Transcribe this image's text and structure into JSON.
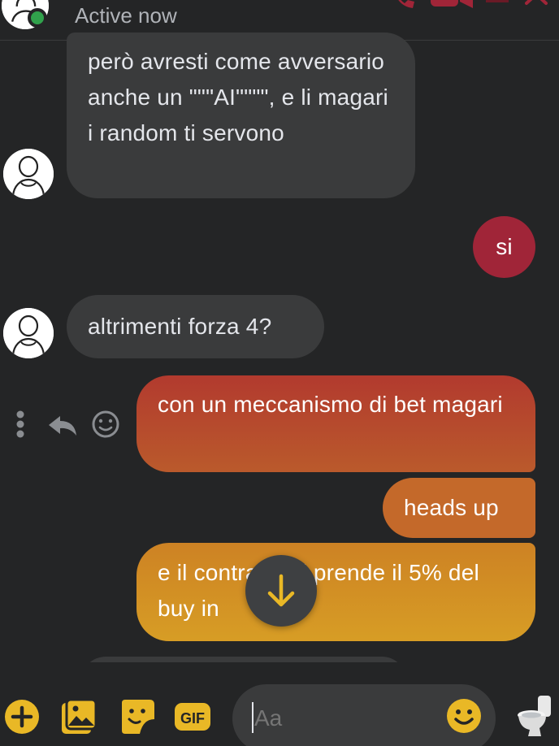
{
  "header": {
    "status": "Active now",
    "avatar_icon": "contact-avatar-icon",
    "online_color": "#31a24c",
    "actions": [
      "phone-icon",
      "video-icon",
      "close-icon"
    ],
    "action_color": "#a02538"
  },
  "messages": [
    {
      "side": "incoming",
      "text": "però avresti come avversario anche un \"\"\"AI\"\"\"\", e li magari i random ti servono"
    },
    {
      "side": "outgoing",
      "text": "si"
    },
    {
      "side": "incoming",
      "text": "altrimenti forza 4?"
    },
    {
      "side": "outgoing",
      "text": "con un meccanismo di bet magari"
    },
    {
      "side": "outgoing",
      "text": "heads up"
    },
    {
      "side": "outgoing",
      "text": "e il contratto si prende il 5% del buy in"
    }
  ],
  "message_actions": [
    "more-icon",
    "reply-icon",
    "react-icon"
  ],
  "scroll_button": {
    "icon": "arrow-down-icon"
  },
  "composer": {
    "tools": [
      "plus-icon",
      "gallery-icon",
      "sticker-icon",
      "gif-icon"
    ],
    "gif_label": "GIF",
    "placeholder": "Aa",
    "value": "",
    "emoji_icon": "emoji-icon",
    "quick_reaction_icon": "toilet-icon",
    "accent": "#e9b826"
  },
  "colors": {
    "background": "#242526",
    "incoming_bubble": "#3a3b3c",
    "outgoing_start": "#a02538",
    "outgoing_end": "#d79d25"
  }
}
